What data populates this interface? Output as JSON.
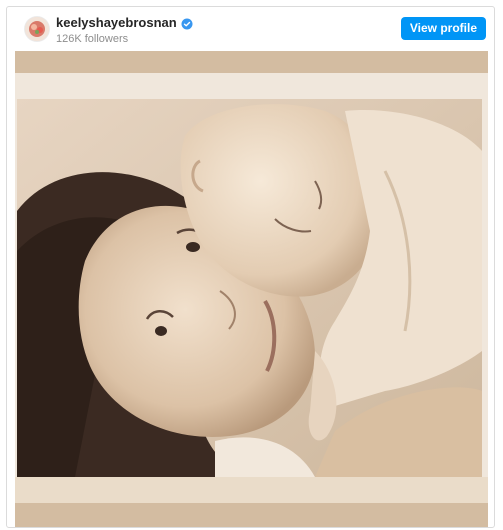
{
  "post": {
    "username": "keelyshayebrosnan",
    "followers": "126K followers",
    "view_profile_label": "View profile",
    "verified": true
  },
  "icons": {
    "avatar": "profile-avatar",
    "verified": "verified-badge-icon"
  },
  "colors": {
    "button_bg": "#0095f6",
    "button_text": "#ffffff",
    "verified_blue": "#3897f0",
    "photo_sepia": "#d8c2a8"
  }
}
